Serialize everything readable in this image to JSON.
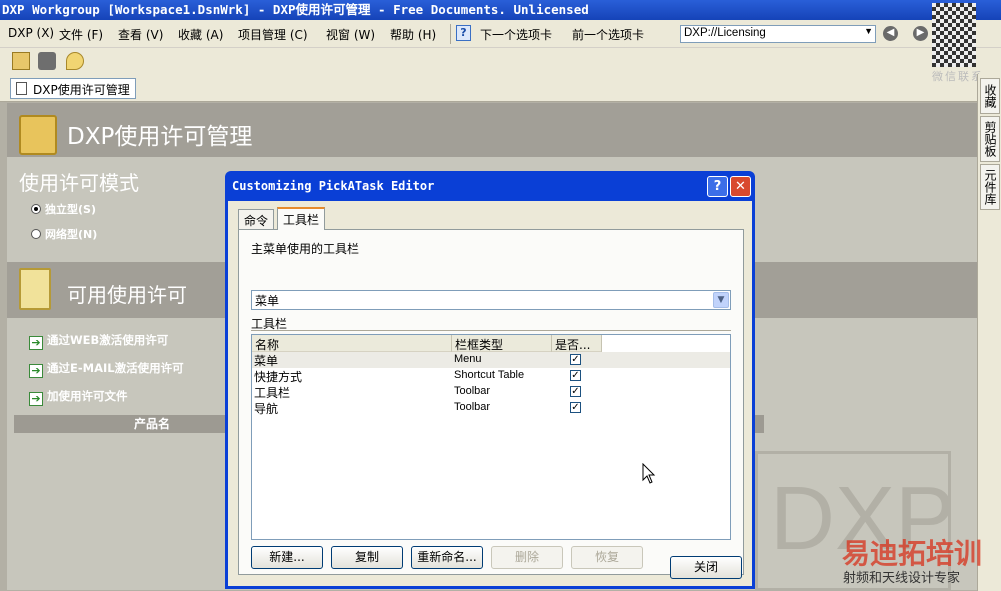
{
  "window": {
    "title": "DXP Workgroup [Workspace1.DsnWrk] - DXP使用许可管理 - Free Documents. Unlicensed"
  },
  "menubar": {
    "items": [
      "DXP (X)",
      "文件 (F)",
      "查看 (V)",
      "收藏 (A)",
      "项目管理 (C)",
      "视窗 (W)",
      "帮助 (H)"
    ],
    "next_tab": "下一个选项卡",
    "prev_tab": "前一个选项卡",
    "address": "DXP://Licensing"
  },
  "doc_tab": {
    "label": "DXP使用许可管理"
  },
  "right_panel": {
    "tabs": [
      "收藏",
      "剪贴板",
      "元件库"
    ]
  },
  "watermark": {
    "wechat_label": "微信联系",
    "brand": "易迪拓培训",
    "slogan": "射频和天线设计专家",
    "logo": "DXP"
  },
  "license_page": {
    "banner_title": "DXP使用许可管理",
    "mode_title": "使用许可模式",
    "modes": [
      {
        "label": "独立型(S)",
        "selected": true
      },
      {
        "label": "网络型(N)",
        "selected": false
      }
    ],
    "available_title": "可用使用许可",
    "actions": [
      "通过WEB激活使用许可",
      "通过E-MAIL激活使用许可",
      "加使用许可文件"
    ],
    "table_header": "产品名"
  },
  "dialog": {
    "title": "Customizing PickATask Editor",
    "tabs": [
      {
        "label": "命令",
        "active": false
      },
      {
        "label": "工具栏",
        "active": true
      }
    ],
    "main_menu_label": "主菜单使用的工具栏",
    "main_menu_value": "菜单",
    "toolbars_label": "工具栏",
    "columns": [
      "名称",
      "栏框类型",
      "是否..."
    ],
    "rows": [
      {
        "name": "菜单",
        "type": "Menu",
        "checked": true
      },
      {
        "name": "快捷方式",
        "type": "Shortcut Table",
        "checked": true
      },
      {
        "name": "工具栏",
        "type": "Toolbar",
        "checked": true
      },
      {
        "name": "导航",
        "type": "Toolbar",
        "checked": true
      }
    ],
    "buttons": [
      "新建...",
      "复制",
      "重新命名...",
      "删除",
      "恢复"
    ],
    "close_label": "关闭"
  }
}
